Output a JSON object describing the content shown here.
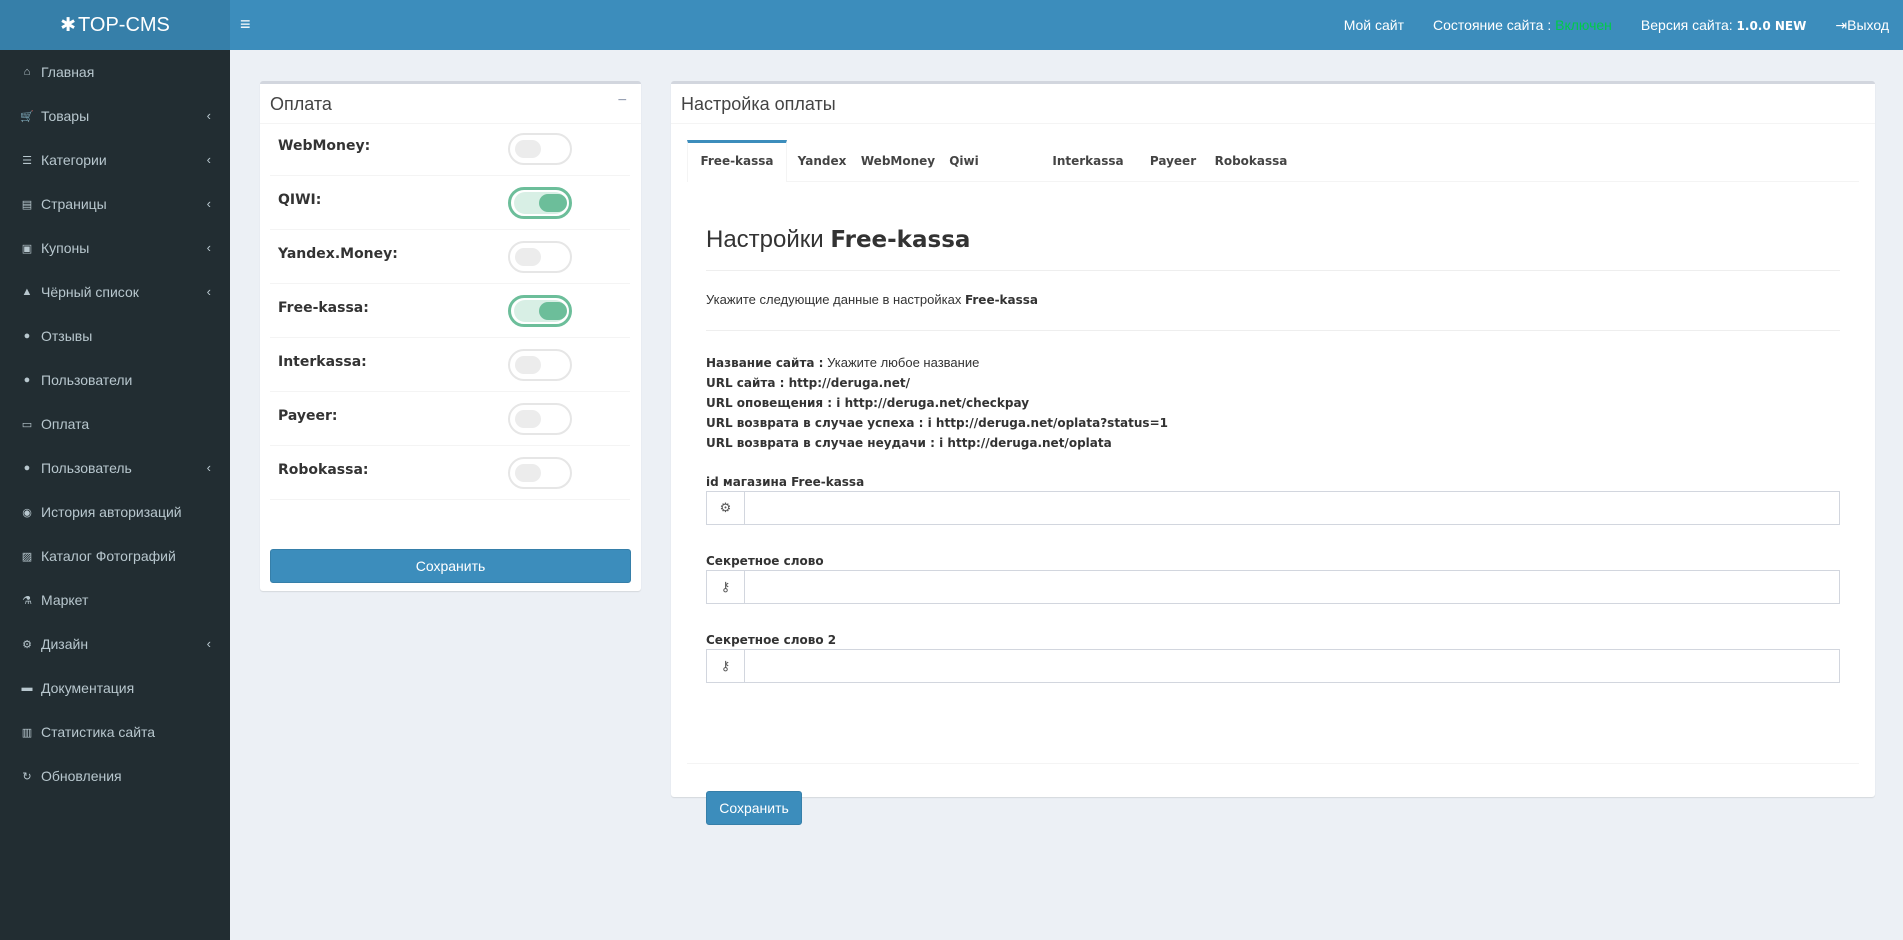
{
  "header": {
    "logo": "TOP-CMS",
    "my_site": "Мой сайт",
    "status_label": "Состояние сайта :",
    "status_value": "Включен",
    "version_label": "Версия сайта:",
    "version_value": "1.0.0 NEW",
    "logout": "Выход"
  },
  "sidebar": {
    "items": [
      {
        "label": "Главная",
        "icon": "home-icon",
        "glyph": "⌂",
        "submenu": false
      },
      {
        "label": "Товары",
        "icon": "cart-icon",
        "glyph": "🛒",
        "submenu": true
      },
      {
        "label": "Категории",
        "icon": "list-icon",
        "glyph": "☰",
        "submenu": true
      },
      {
        "label": "Страницы",
        "icon": "file-icon",
        "glyph": "▤",
        "submenu": true
      },
      {
        "label": "Купоны",
        "icon": "gift-icon",
        "glyph": "▣",
        "submenu": true
      },
      {
        "label": "Чёрный список",
        "icon": "lock-icon",
        "glyph": "▲",
        "submenu": true
      },
      {
        "label": "Отзывы",
        "icon": "comments-icon",
        "glyph": "●",
        "submenu": false
      },
      {
        "label": "Пользователи",
        "icon": "users-icon",
        "glyph": "●",
        "submenu": false
      },
      {
        "label": "Оплата",
        "icon": "money-icon",
        "glyph": "▭",
        "submenu": false
      },
      {
        "label": "Пользователь",
        "icon": "user-icon",
        "glyph": "●",
        "submenu": true
      },
      {
        "label": "История авторизаций",
        "icon": "eye-slash-icon",
        "glyph": "◉",
        "submenu": false
      },
      {
        "label": "Каталог Фотографий",
        "icon": "image-icon",
        "glyph": "▨",
        "submenu": false
      },
      {
        "label": "Маркет",
        "icon": "flask-icon",
        "glyph": "⚗",
        "submenu": false
      },
      {
        "label": "Дизайн",
        "icon": "cogs-icon",
        "glyph": "⚙",
        "submenu": true
      },
      {
        "label": "Документация",
        "icon": "book-icon",
        "glyph": "▬",
        "submenu": false
      },
      {
        "label": "Статистика сайта",
        "icon": "bar-chart-icon",
        "glyph": "▥",
        "submenu": false
      },
      {
        "label": "Обновления",
        "icon": "refresh-icon",
        "glyph": "↻",
        "submenu": false
      }
    ]
  },
  "payment_box": {
    "title": "Оплата",
    "methods": [
      {
        "label": "WebMoney:",
        "enabled": false
      },
      {
        "label": "QIWI:",
        "enabled": true
      },
      {
        "label": "Yandex.Money:",
        "enabled": false
      },
      {
        "label": "Free-kassa:",
        "enabled": true
      },
      {
        "label": "Interkassa:",
        "enabled": false
      },
      {
        "label": "Payeer:",
        "enabled": false
      },
      {
        "label": "Robokassa:",
        "enabled": false
      }
    ],
    "save_label": "Сохранить"
  },
  "settings_box": {
    "title": "Настройка оплаты",
    "tabs": [
      "Free-kassa",
      "Yandex",
      "WebMoney",
      "Qiwi",
      "Interkassa",
      "Payeer",
      "Robokassa"
    ],
    "active_tab": "Free-kassa",
    "heading_prefix": "Настройки",
    "heading_name": "Free-kassa",
    "intro_text": "Укажите следующие данные в настройках",
    "intro_name": "Free-kassa",
    "info": {
      "site_name_label": "Название сайта :",
      "site_name_value": "Укажите любое название",
      "site_url": "URL сайта : http://deruga.net/",
      "notify_url": "URL оповещения : i http://deruga.net/checkpay",
      "success_url": "URL возврата в случае успеха : i http://deruga.net/oplata?status=1",
      "fail_url": "URL возврата в случае неудачи : i http://deruga.net/oplata"
    },
    "fields": [
      {
        "label": "id магазина Free-kassa",
        "icon": "gear-icon",
        "glyph": "⚙",
        "value": ""
      },
      {
        "label": "Секретное слово",
        "icon": "key-icon",
        "glyph": "⚷",
        "value": ""
      },
      {
        "label": "Секретное слово 2",
        "icon": "key-icon",
        "glyph": "⚷",
        "value": ""
      }
    ],
    "save_label": "Сохранить"
  }
}
